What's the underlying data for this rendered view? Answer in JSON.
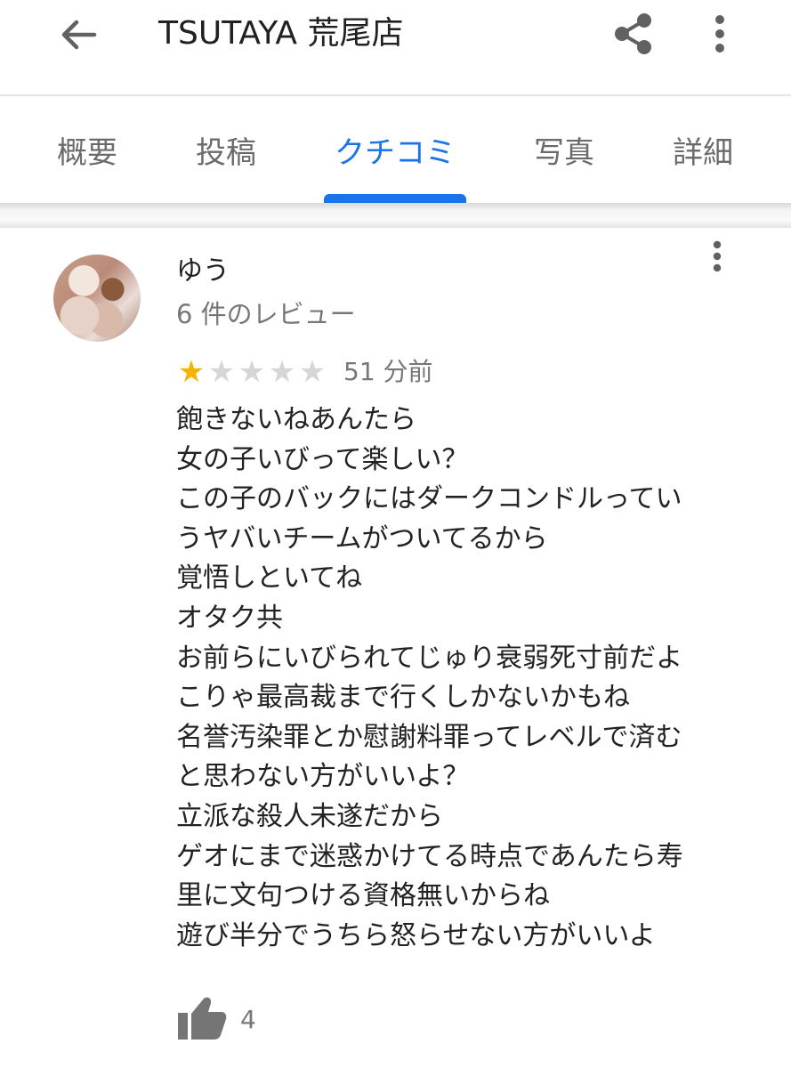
{
  "appbar": {
    "title": "TSUTAYA 荒尾店",
    "back_icon": "arrow-back-icon",
    "share_icon": "share-icon",
    "more_icon": "more-vert-icon"
  },
  "tabs": [
    {
      "label": "概要",
      "active": false
    },
    {
      "label": "投稿",
      "active": false
    },
    {
      "label": "クチコミ",
      "active": true
    },
    {
      "label": "写真",
      "active": false
    },
    {
      "label": "詳細",
      "active": false
    }
  ],
  "accent_color": "#1a73e8",
  "review": {
    "author": "ゆう",
    "review_count": "6 件のレビュー",
    "rating": 1,
    "rating_max": 5,
    "star_color": "#f4b400",
    "time": "51 分前",
    "lines": [
      "飽きないねあんたら",
      "女の子いびって楽しい？",
      "この子のバックにはダークコンドルってい",
      "うヤバいチームがついてるから",
      "覚悟しといてね",
      "オタク共",
      "お前らにいびられてじゅり衰弱死寸前だよ",
      "こりゃ最高裁まで行くしかないかもね",
      "名誉汚染罪とか慰謝料罪ってレベルで済む",
      "と思わない方がいいよ？",
      "立派な殺人未遂だから",
      "ゲオにまで迷惑かけてる時点であんたら寿",
      "里に文句つける資格無いからね",
      "遊び半分でうちら怒らせない方がいいよ"
    ],
    "likes": "4",
    "like_icon": "thumb-up-icon"
  }
}
